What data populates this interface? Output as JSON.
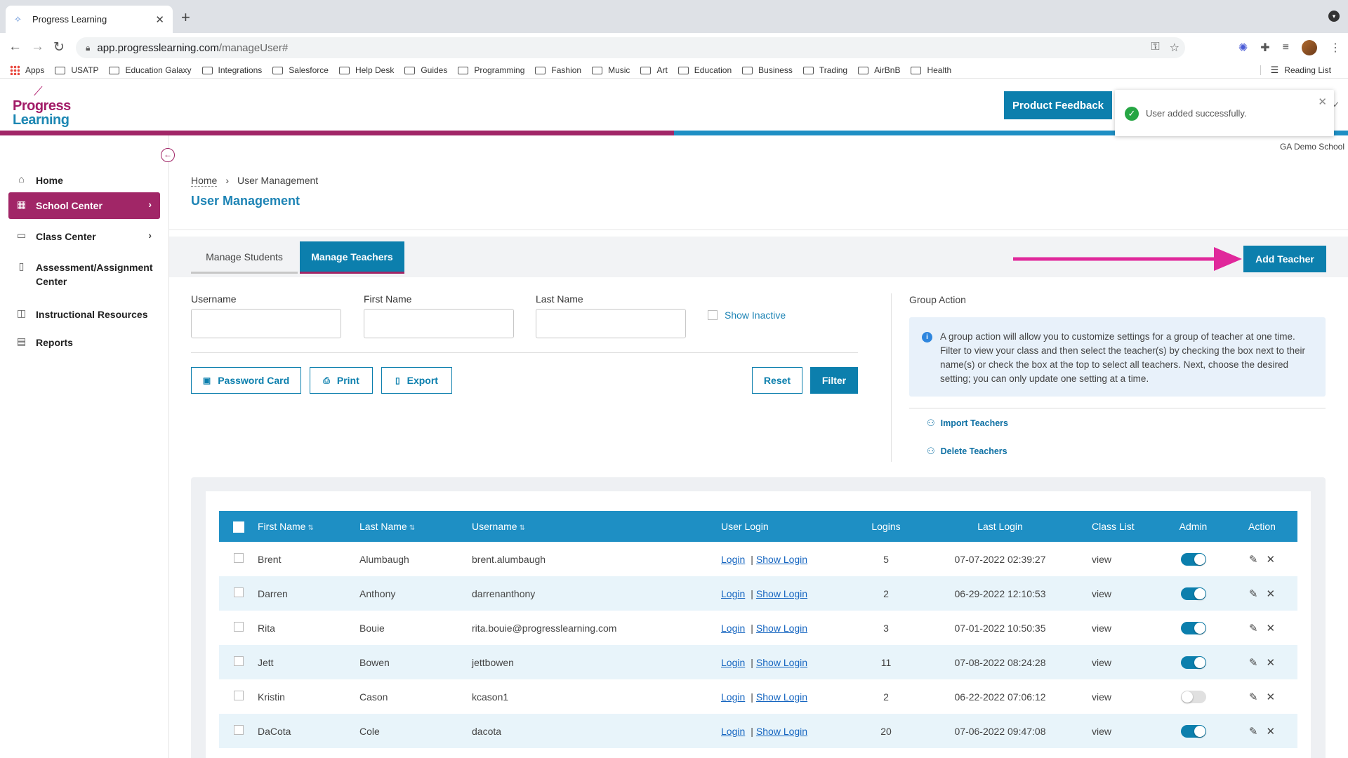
{
  "browser": {
    "tab_title": "Progress Learning",
    "url_host": "app.progresslearning.com",
    "url_path": "/manageUser#",
    "bookmarks": [
      "Apps",
      "USATP",
      "Education Galaxy",
      "Integrations",
      "Salesforce",
      "Help Desk",
      "Guides",
      "Programming",
      "Fashion",
      "Music",
      "Art",
      "Education",
      "Business",
      "Trading",
      "AirBnB",
      "Health"
    ],
    "reading_list": "Reading List"
  },
  "header": {
    "logo_line1": "Progress",
    "logo_line2": "Learning",
    "feedback_button": "Product Feedback",
    "school_name": "GA Demo School"
  },
  "toast": {
    "message": "User added successfully.",
    "color": "#26a644"
  },
  "sidebar": {
    "items": [
      {
        "label": "Home",
        "icon": "home-icon"
      },
      {
        "label": "School Center",
        "icon": "school-icon",
        "active": true
      },
      {
        "label": "Class Center",
        "icon": "class-icon"
      },
      {
        "label": "Assessment/Assignment Center",
        "icon": "book-icon"
      },
      {
        "label": "Instructional Resources",
        "icon": "book-open-icon"
      },
      {
        "label": "Reports",
        "icon": "report-icon"
      }
    ]
  },
  "breadcrumb": {
    "home": "Home",
    "current": "User Management"
  },
  "page_title": "User Management",
  "tabs": {
    "students": "Manage Students",
    "teachers": "Manage Teachers"
  },
  "add_teacher": "Add Teacher",
  "filters": {
    "username_label": "Username",
    "first_name_label": "First Name",
    "last_name_label": "Last Name",
    "show_inactive": "Show Inactive"
  },
  "buttons": {
    "password_card": "Password Card",
    "print": "Print",
    "export": "Export",
    "reset": "Reset",
    "filter": "Filter"
  },
  "group_action": {
    "title": "Group Action",
    "info": "A group action will allow you to customize settings for a group of teacher at one time. Filter to view your class and then select the teacher(s) by checking the box next to their name(s) or check the box at the top to select all teachers. Next, choose the desired setting; you can only update one setting at a time.",
    "import": "Import Teachers",
    "delete": "Delete Teachers"
  },
  "table": {
    "headers": {
      "first_name": "First Name",
      "last_name": "Last Name",
      "username": "Username",
      "user_login": "User Login",
      "logins": "Logins",
      "last_login": "Last Login",
      "class_list": "Class List",
      "admin": "Admin",
      "action": "Action"
    },
    "login_link": "Login",
    "show_login_link": "Show Login",
    "rows": [
      {
        "first": "Brent",
        "last": "Alumbaugh",
        "username": "brent.alumbaugh",
        "logins": "5",
        "last_login": "07-07-2022 02:39:27",
        "class_list": "view",
        "admin": true
      },
      {
        "first": "Darren",
        "last": "Anthony",
        "username": "darrenanthony",
        "logins": "2",
        "last_login": "06-29-2022 12:10:53",
        "class_list": "view",
        "admin": true
      },
      {
        "first": "Rita",
        "last": "Bouie",
        "username": "rita.bouie@progresslearning.com",
        "logins": "3",
        "last_login": "07-01-2022 10:50:35",
        "class_list": "view",
        "admin": true
      },
      {
        "first": "Jett",
        "last": "Bowen",
        "username": "jettbowen",
        "logins": "11",
        "last_login": "07-08-2022 08:24:28",
        "class_list": "view",
        "admin": true
      },
      {
        "first": "Kristin",
        "last": "Cason",
        "username": "kcason1",
        "logins": "2",
        "last_login": "06-22-2022 07:06:12",
        "class_list": "view",
        "admin": false
      },
      {
        "first": "DaCota",
        "last": "Cole",
        "username": "dacota",
        "logins": "20",
        "last_login": "07-06-2022 09:47:08",
        "class_list": "view",
        "admin": true
      }
    ]
  },
  "colors": {
    "brand_magenta": "#a12667",
    "brand_blue": "#0c7fad",
    "arrow": "#e0289b"
  }
}
